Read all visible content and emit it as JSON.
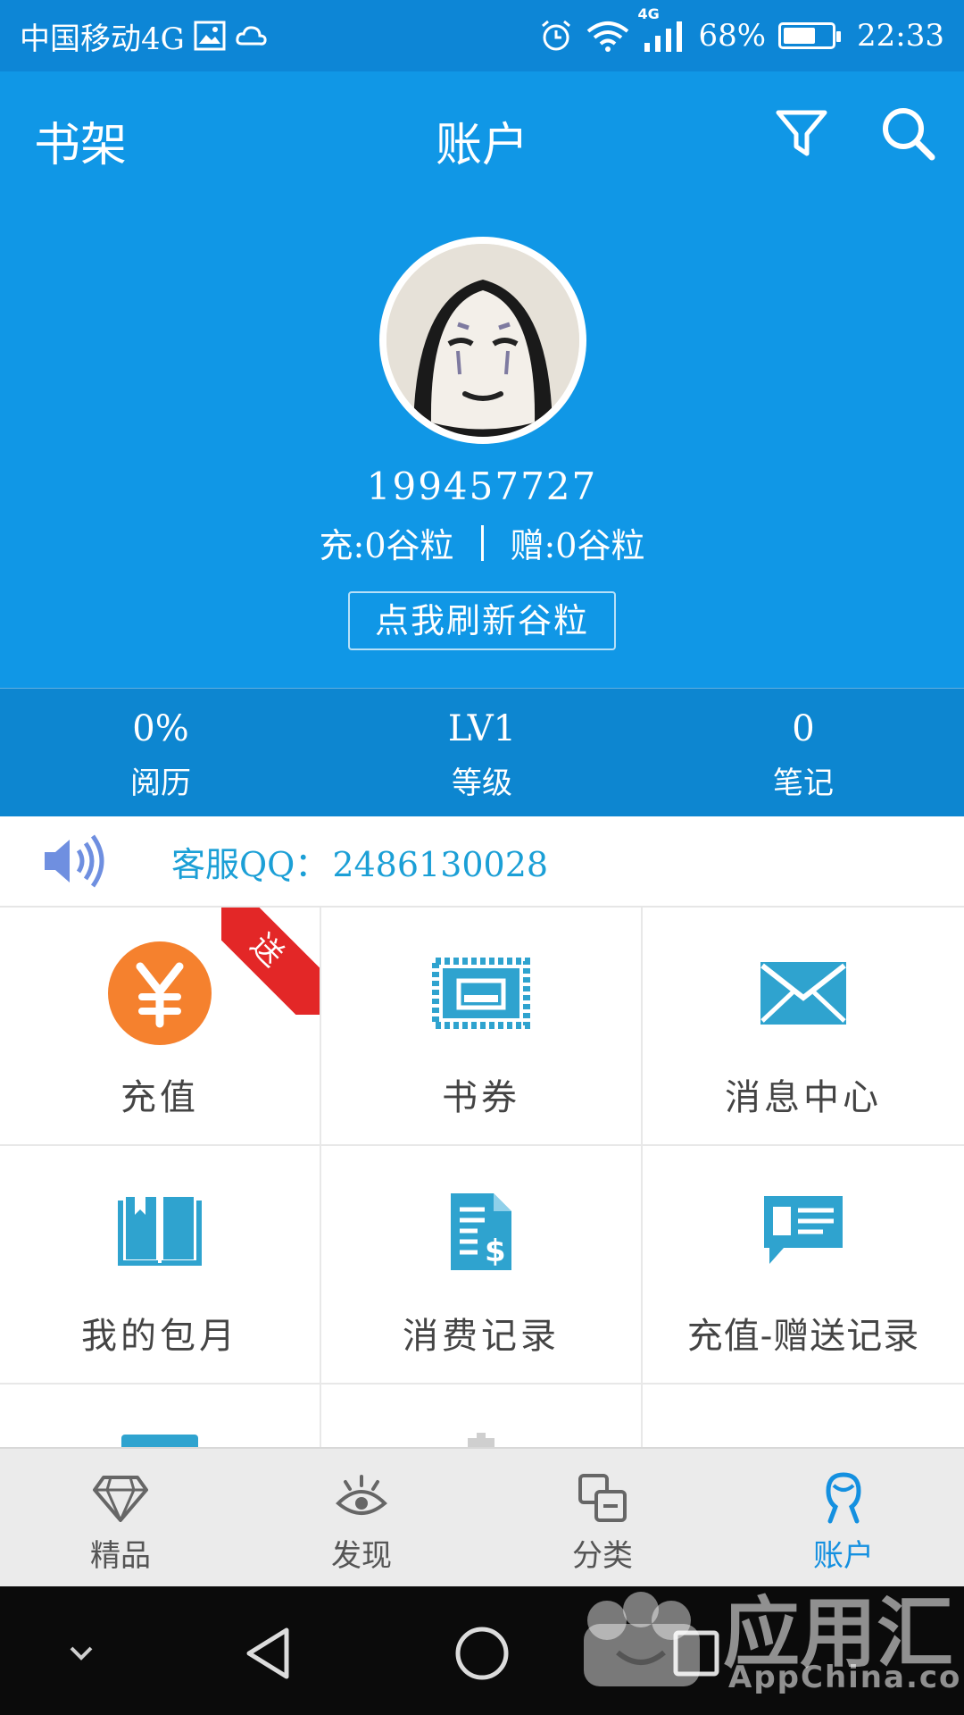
{
  "status_bar": {
    "carrier": "中国移动4G",
    "network": "4G",
    "battery_percent": "68%",
    "battery_level": 0.68,
    "time": "22:33"
  },
  "appbar": {
    "left_title": "书架",
    "center_title": "账户"
  },
  "profile": {
    "username": "199457727",
    "recharge_balance": "充:0谷粒",
    "gift_balance": "赠:0谷粒",
    "refresh_label": "点我刷新谷粒"
  },
  "stats": [
    {
      "value": "0%",
      "label": "阅历"
    },
    {
      "value": "LV1",
      "label": "等级"
    },
    {
      "value": "0",
      "label": "笔记"
    }
  ],
  "service": {
    "label": "客服QQ：",
    "qq": "2486130028"
  },
  "grid": [
    {
      "label": "充值",
      "icon": "yuan-coin-icon",
      "badge": "送"
    },
    {
      "label": "书券",
      "icon": "ticket-icon"
    },
    {
      "label": "消息中心",
      "icon": "envelope-icon"
    },
    {
      "label": "我的包月",
      "icon": "open-book-icon"
    },
    {
      "label": "消费记录",
      "icon": "bill-dollar-icon"
    },
    {
      "label": "充值-赠送记录",
      "icon": "chat-card-icon"
    }
  ],
  "bottom_nav": [
    {
      "label": "精品",
      "icon": "diamond-icon"
    },
    {
      "label": "发现",
      "icon": "eye-icon"
    },
    {
      "label": "分类",
      "icon": "squares-icon"
    },
    {
      "label": "账户",
      "icon": "user-icon",
      "active": true
    }
  ],
  "watermark": {
    "title": "应用汇",
    "subtitle": "AppChina.com"
  },
  "colors": {
    "primary": "#1097e6",
    "stats_bg": "#0d86d0",
    "accent_text": "#1b9fd6",
    "icon_teal": "#2fa3cf",
    "coin_orange": "#f5812e",
    "ribbon_red": "#e32727"
  }
}
